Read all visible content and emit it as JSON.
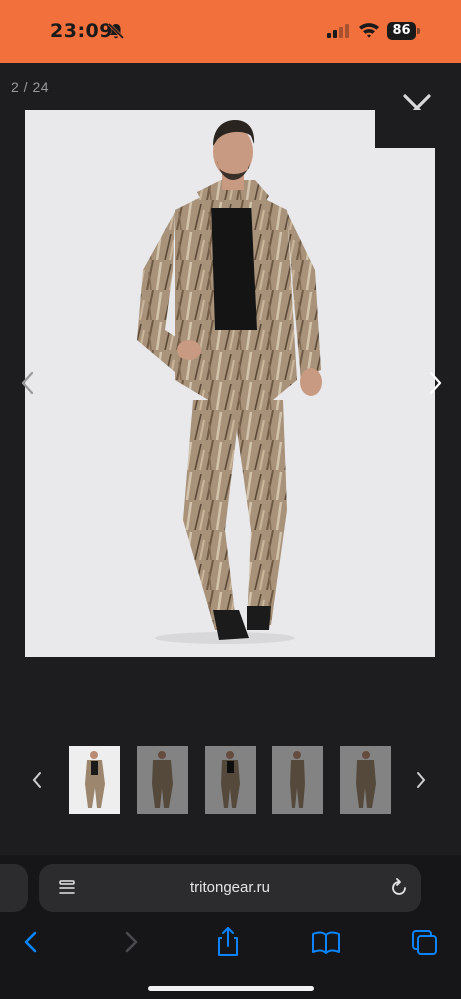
{
  "status_bar": {
    "time": "23:09",
    "battery": "86",
    "background_color": "#f2703c",
    "icons": [
      "bell-slash-icon",
      "signal-icon",
      "wifi-icon",
      "battery-icon"
    ]
  },
  "gallery": {
    "counter": "2 / 24",
    "close_icon": "close-icon",
    "prev_icon": "chevron-left-icon",
    "next_icon": "chevron-right-icon",
    "thumbnails": [
      {
        "name": "thumb-1",
        "selected": true
      },
      {
        "name": "thumb-2",
        "selected": false
      },
      {
        "name": "thumb-3",
        "selected": false
      },
      {
        "name": "thumb-4",
        "selected": false
      },
      {
        "name": "thumb-5",
        "selected": false
      }
    ]
  },
  "browser": {
    "url": "tritongear.ru",
    "toolbar_icons": [
      "back-icon",
      "forward-icon",
      "share-icon",
      "bookmarks-icon",
      "tabs-icon"
    ],
    "accent_color": "#0a84ff"
  }
}
